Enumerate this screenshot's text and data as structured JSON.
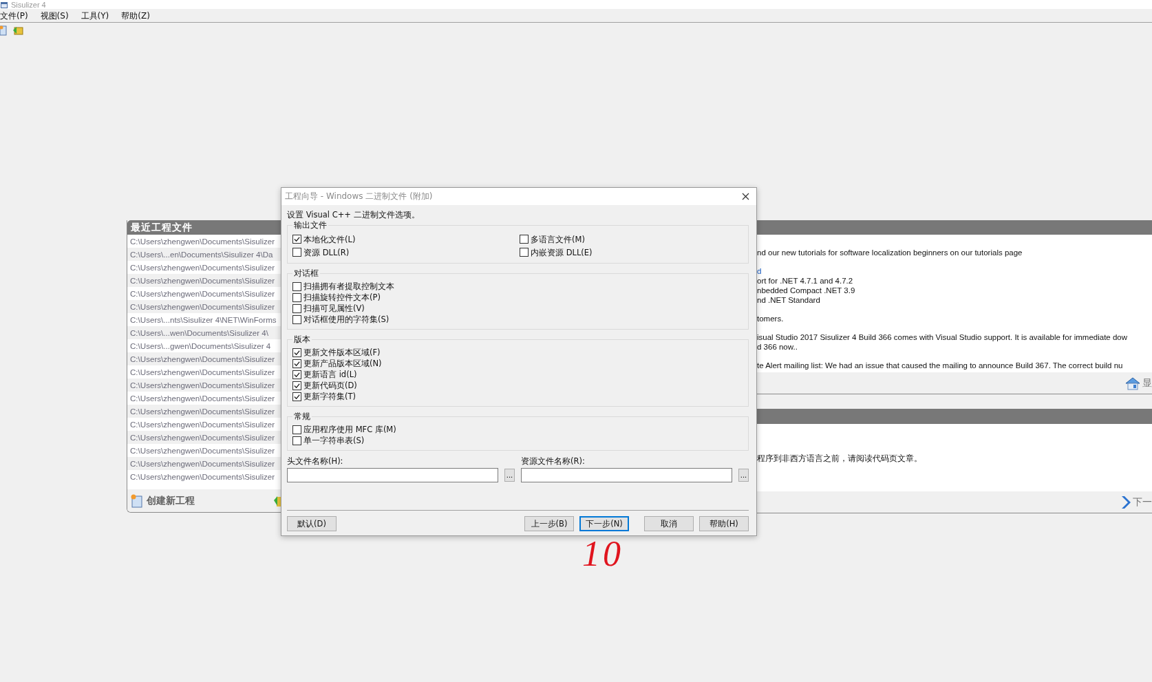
{
  "window": {
    "title": "Sisulizer 4"
  },
  "menu": [
    "文件(P)",
    "视图(S)",
    "工具(Y)",
    "帮助(Z)"
  ],
  "recent_projects": {
    "title": "最近工程文件",
    "items": [
      "C:\\Users\\zhengwen\\Documents\\Sisulizer",
      "C:\\Users\\...en\\Documents\\Sisulizer 4\\Da",
      "C:\\Users\\zhengwen\\Documents\\Sisulizer",
      "C:\\Users\\zhengwen\\Documents\\Sisulizer",
      "C:\\Users\\zhengwen\\Documents\\Sisulizer",
      "C:\\Users\\zhengwen\\Documents\\Sisulizer",
      "C:\\Users\\...nts\\Sisulizer 4\\NET\\WinForms",
      "C:\\Users\\...wen\\Documents\\Sisulizer 4\\",
      "C:\\Users\\...gwen\\Documents\\Sisulizer 4",
      "C:\\Users\\zhengwen\\Documents\\Sisulizer",
      "C:\\Users\\zhengwen\\Documents\\Sisulizer",
      "C:\\Users\\zhengwen\\Documents\\Sisulizer",
      "C:\\Users\\zhengwen\\Documents\\Sisulizer",
      "C:\\Users\\zhengwen\\Documents\\Sisulizer",
      "C:\\Users\\zhengwen\\Documents\\Sisulizer",
      "C:\\Users\\zhengwen\\Documents\\Sisulizer",
      "C:\\Users\\zhengwen\\Documents\\Sisulizer",
      "C:\\Users\\zhengwen\\Documents\\Sisulizer",
      "C:\\Users\\zhengwen\\Documents\\Sisulizer"
    ],
    "footer_action": "创建新工程"
  },
  "news_panel": {
    "paragraphs": [
      [
        {
          "kind": "text",
          "text": "nd our new tutorials for software localization beginners on our tutorials page"
        }
      ],
      [
        {
          "kind": "link",
          "text": "d"
        },
        {
          "kind": "text",
          "text": "ort for .NET 4.7.1 and 4.7.2"
        },
        {
          "kind": "text",
          "text": "nbedded Compact .NET 3.9"
        },
        {
          "kind": "text",
          "text": "nd .NET Standard"
        }
      ],
      [
        {
          "kind": "text",
          "text": "tomers."
        }
      ],
      [
        {
          "kind": "text",
          "text": "isual Studio 2017 Sisulizer 4 Build 366 comes with Visual Studio support. It is available for immediate dow"
        },
        {
          "kind": "text",
          "text": "d 366 now.."
        }
      ],
      [
        {
          "kind": "text",
          "text": "te Alert mailing list: We had an issue that caused the mailing to announce Build 367. The correct build nu"
        }
      ]
    ],
    "footer_action": "显"
  },
  "tip_panel": {
    "paragraphs": [
      [
        {
          "kind": "text",
          "text": "程序到非西方语言之前，请阅读代码页文章。"
        }
      ]
    ],
    "footer_action": "下一"
  },
  "dialog": {
    "title": "工程向导 - Windows 二进制文件 (附加)",
    "intro": "设置 Visual C++ 二进制文件选项。",
    "groups": [
      {
        "title": "输出文件",
        "rows": [
          [
            {
              "label": "本地化文件(L)",
              "checked": true
            },
            {
              "label": "多语言文件(M)",
              "checked": false
            }
          ],
          [
            {
              "label": "资源 DLL(R)",
              "checked": false
            },
            {
              "label": "内嵌资源 DLL(E)",
              "checked": false
            }
          ]
        ]
      },
      {
        "title": "对话框",
        "rows": [
          [
            {
              "label": "扫描拥有者提取控制文本",
              "checked": false
            }
          ],
          [
            {
              "label": "扫描旋转控件文本(P)",
              "checked": false
            }
          ],
          [
            {
              "label": "扫描可见属性(V)",
              "checked": false
            }
          ],
          [
            {
              "label": "对话框使用的字符集(S)",
              "checked": false
            }
          ]
        ]
      },
      {
        "title": "版本",
        "rows": [
          [
            {
              "label": "更新文件版本区域(F)",
              "checked": true
            }
          ],
          [
            {
              "label": "更新产品版本区域(N)",
              "checked": true
            }
          ],
          [
            {
              "label": "更新语言 id(L)",
              "checked": true
            }
          ],
          [
            {
              "label": "更新代码页(D)",
              "checked": true
            }
          ],
          [
            {
              "label": "更新字符集(T)",
              "checked": true
            }
          ]
        ]
      },
      {
        "title": "常规",
        "rows": [
          [
            {
              "label": "应用程序使用 MFC 库(M)",
              "checked": false
            }
          ],
          [
            {
              "label": "单一字符串表(S)",
              "checked": false
            }
          ]
        ]
      }
    ],
    "fields": [
      {
        "label": "头文件名称(H):",
        "browse": "..."
      },
      {
        "label": "资源文件名称(R):",
        "browse": "..."
      }
    ],
    "button_groups": [
      {
        "buttons": [
          {
            "label": "默认(D)",
            "focused": false
          }
        ]
      },
      {
        "buttons": [
          {
            "label": "上一步(B)",
            "focused": false
          },
          {
            "label": "下一步(N)",
            "focused": true
          }
        ]
      },
      {
        "buttons": [
          {
            "label": "取消",
            "focused": false
          },
          {
            "label": "帮助(H)",
            "focused": false
          }
        ]
      }
    ]
  },
  "annotation": "10"
}
